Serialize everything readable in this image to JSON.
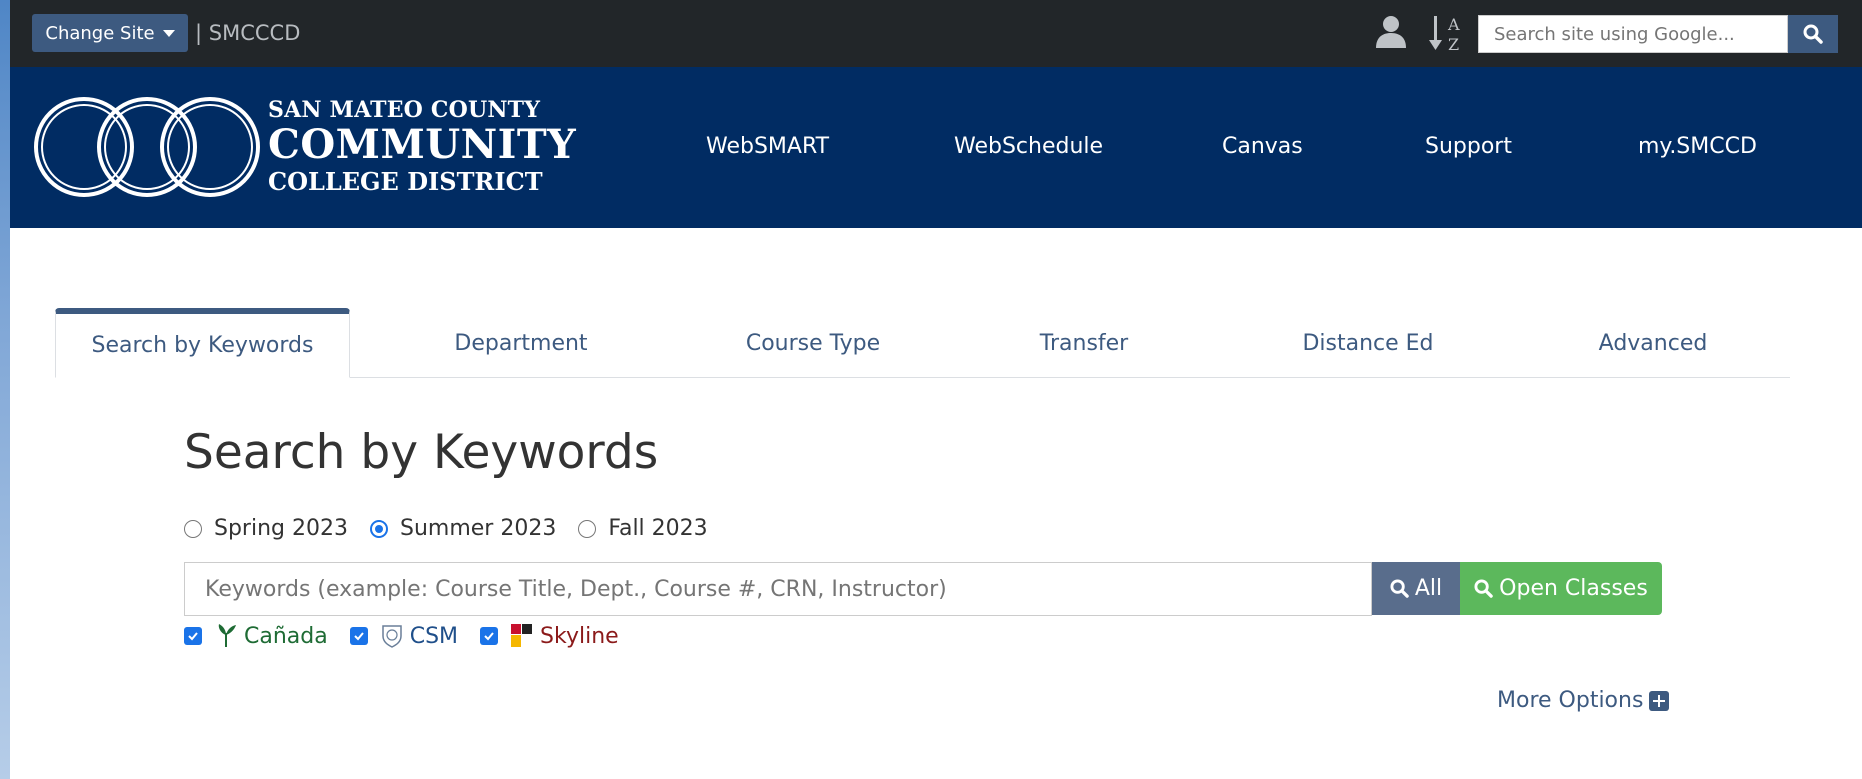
{
  "topbar": {
    "change_site_label": "Change Site",
    "site_name": "| SMCCCD",
    "user_icon": "user-icon",
    "az_icon": "a-z-index-icon",
    "search_placeholder": "Search site using Google...",
    "search_icon": "search-icon"
  },
  "header": {
    "logo_line1": "SAN MATEO COUNTY",
    "logo_line2": "COMMUNITY",
    "logo_line3": "COLLEGE DISTRICT",
    "nav": [
      "WebSMART",
      "WebSchedule",
      "Canvas",
      "Support",
      "my.SMCCD"
    ]
  },
  "tabs": [
    {
      "label": "Search by Keywords",
      "active": true
    },
    {
      "label": "Department"
    },
    {
      "label": "Course Type"
    },
    {
      "label": "Transfer"
    },
    {
      "label": "Distance Ed"
    },
    {
      "label": "Advanced"
    }
  ],
  "search": {
    "heading": "Search by Keywords",
    "terms": [
      {
        "label": "Spring 2023",
        "checked": false
      },
      {
        "label": "Summer 2023",
        "checked": true
      },
      {
        "label": "Fall 2023",
        "checked": false
      }
    ],
    "keyword_placeholder": "Keywords (example: Course Title, Dept., Course #, CRN, Instructor)",
    "all_button": "All",
    "open_classes_button": "Open Classes",
    "campuses": [
      {
        "label": "Cañada",
        "checked": true,
        "color": "#1e6b34"
      },
      {
        "label": "CSM",
        "checked": true,
        "color": "#1f4f8a"
      },
      {
        "label": "Skyline",
        "checked": true,
        "color": "#8b1a1a"
      }
    ],
    "more_options": "More Options"
  },
  "colors": {
    "topbar": "#222629",
    "header": "#012c63",
    "accent": "#3d5a80",
    "open_classes": "#5cb85c"
  }
}
